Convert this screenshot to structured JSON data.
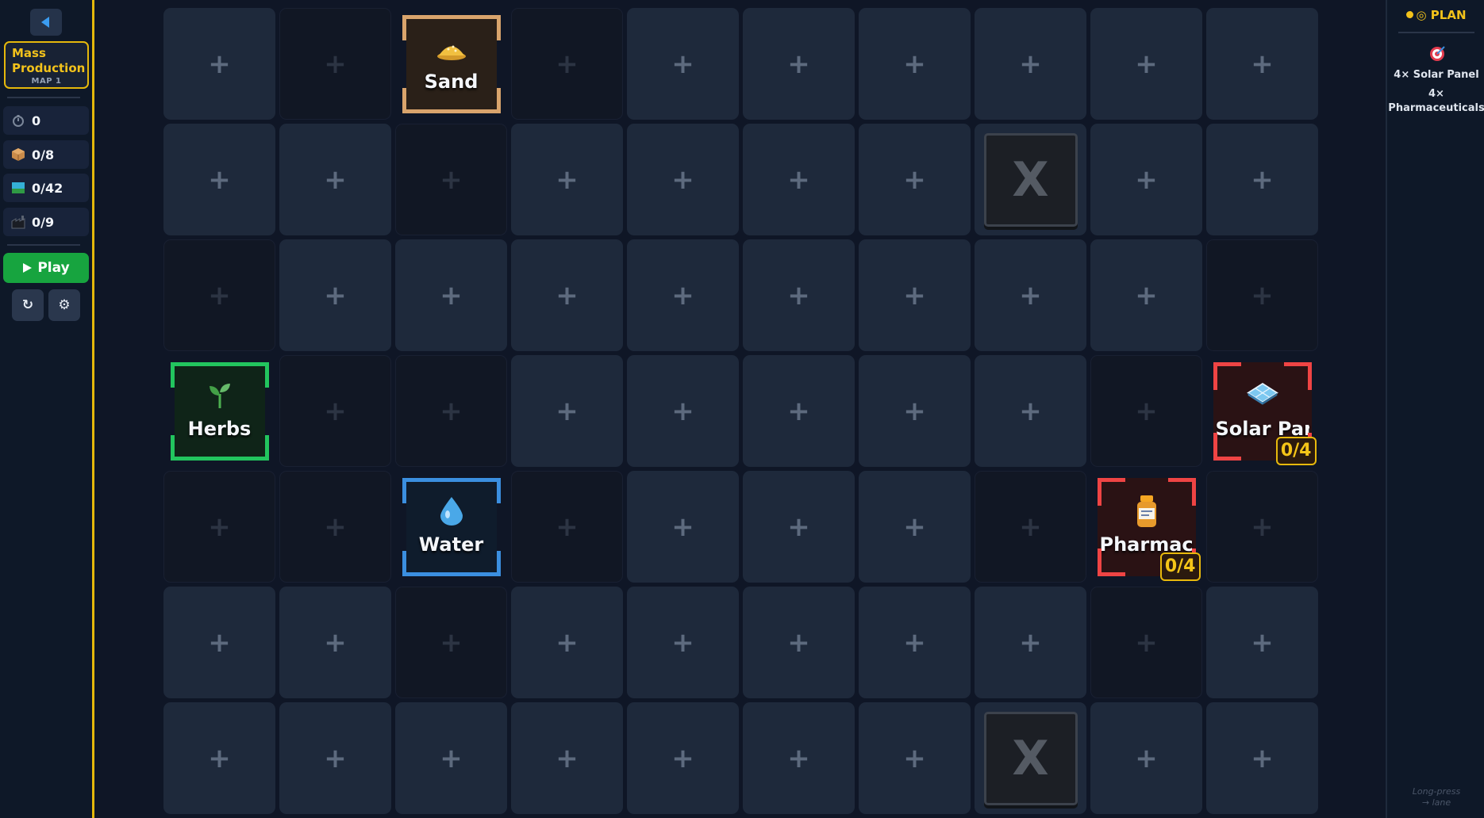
{
  "sidebar": {
    "back_icon": "back-arrow-icon",
    "level": {
      "title": "Mass\nProduction",
      "map": "MAP 1"
    },
    "stats": [
      {
        "icon": "timer-icon",
        "value": "0"
      },
      {
        "icon": "box-icon",
        "value": "0/8"
      },
      {
        "icon": "conveyor-icon",
        "value": "0/42"
      },
      {
        "icon": "factory-icon",
        "value": "0/9"
      }
    ],
    "play_label": "Play",
    "restart_icon": "restart-icon",
    "settings_icon": "gear-icon"
  },
  "grid": {
    "rows": 7,
    "cols": 10,
    "empty_symbol": "+",
    "blocked_symbol": "X",
    "dark_cells": [
      [
        0,
        1
      ],
      [
        0,
        3
      ],
      [
        1,
        2
      ],
      [
        2,
        0
      ],
      [
        2,
        9
      ],
      [
        3,
        1
      ],
      [
        3,
        2
      ],
      [
        3,
        8
      ],
      [
        4,
        0
      ],
      [
        4,
        1
      ],
      [
        4,
        3
      ],
      [
        4,
        7
      ],
      [
        4,
        9
      ],
      [
        5,
        2
      ],
      [
        5,
        8
      ]
    ],
    "blocked_cells": [
      [
        1,
        7
      ],
      [
        6,
        7
      ]
    ],
    "resources": [
      {
        "row": 0,
        "col": 2,
        "label": "Sand",
        "icon": "sand-icon",
        "color": "#d9a46c",
        "bg": "#2a2018"
      },
      {
        "row": 3,
        "col": 0,
        "label": "Herbs",
        "icon": "sprout-icon",
        "color": "#22c55e",
        "bg": "#0f2418"
      },
      {
        "row": 4,
        "col": 2,
        "label": "Water",
        "icon": "water-drop-icon",
        "color": "#3b8fe0",
        "bg": "#0f1c2c"
      }
    ],
    "targets": [
      {
        "row": 3,
        "col": 9,
        "label": "Solar Panel",
        "icon": "solar-panel-icon",
        "color": "#ef4444",
        "bg": "#2a1214",
        "progress": "0/4"
      },
      {
        "row": 4,
        "col": 8,
        "label": "Pharmaceuticals",
        "icon": "medicine-bottle-icon",
        "color": "#ef4444",
        "bg": "#2a1214",
        "progress": "0/4"
      }
    ]
  },
  "plan": {
    "title": "◎ PLAN",
    "target_icon": "target-icon",
    "items": [
      "4× Solar Panel",
      "4×\nPharmaceuticals"
    ],
    "hint": "Long-press\n→ lane"
  },
  "colors": {
    "accent": "#e5b80b",
    "play": "#17a43f",
    "background": "#0f1626"
  }
}
